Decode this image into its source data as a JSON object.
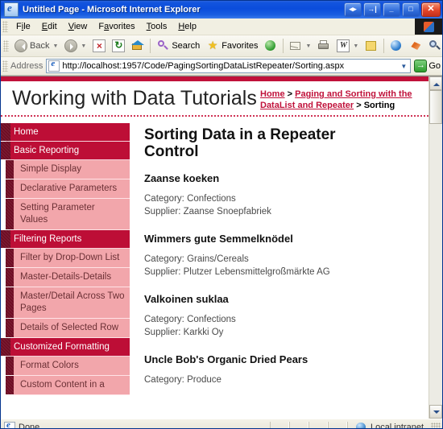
{
  "window": {
    "title": "Untitled Page - Microsoft Internet Explorer",
    "controls": {
      "restore_group_label": "◂▸",
      "split_label": "→|",
      "minimize_label": "_",
      "maximize_label": "□",
      "close_label": "✕"
    }
  },
  "menubar": {
    "items": [
      {
        "pre": "F",
        "accel": "i",
        "post": "le"
      },
      {
        "pre": "",
        "accel": "E",
        "post": "dit"
      },
      {
        "pre": "",
        "accel": "V",
        "post": "iew"
      },
      {
        "pre": "F",
        "accel": "a",
        "post": "vorites"
      },
      {
        "pre": "",
        "accel": "T",
        "post": "ools"
      },
      {
        "pre": "",
        "accel": "H",
        "post": "elp"
      }
    ]
  },
  "toolbar": {
    "back_label": "Back",
    "search_label": "Search",
    "favorites_label": "Favorites"
  },
  "address": {
    "label": "Address",
    "url": "http://localhost:1957/Code/PagingSortingDataListRepeater/Sorting.aspx",
    "go_label": "Go"
  },
  "page": {
    "title": "Working with Data Tutorials",
    "breadcrumb": {
      "home": "Home",
      "sep1": " > ",
      "section": "Paging and Sorting with the DataList and Repeater",
      "sep2": " > ",
      "current": "Sorting"
    },
    "content_heading": "Sorting Data in a Repeater Control",
    "label_category": "Category: ",
    "label_supplier": "Supplier: ",
    "products": [
      {
        "name": "Zaanse koeken",
        "category": "Confections",
        "supplier": "Zaanse Snoepfabriek"
      },
      {
        "name": "Wimmers gute Semmelknödel",
        "category": "Grains/Cereals",
        "supplier": "Plutzer Lebensmittelgroßmärkte AG"
      },
      {
        "name": "Valkoinen suklaa",
        "category": "Confections",
        "supplier": "Karkki Oy"
      },
      {
        "name": "Uncle Bob's Organic Dried Pears",
        "category": "Produce",
        "supplier": ""
      }
    ]
  },
  "sidebar": {
    "items": [
      {
        "label": "Home",
        "type": "section"
      },
      {
        "label": "Basic Reporting",
        "type": "section"
      },
      {
        "label": "Simple Display",
        "type": "item"
      },
      {
        "label": "Declarative Parameters",
        "type": "item"
      },
      {
        "label": "Setting Parameter Values",
        "type": "item"
      },
      {
        "label": "Filtering Reports",
        "type": "section"
      },
      {
        "label": "Filter by Drop-Down List",
        "type": "item"
      },
      {
        "label": "Master-Details-Details",
        "type": "item"
      },
      {
        "label": "Master/Detail Across Two Pages",
        "type": "item"
      },
      {
        "label": "Details of Selected Row",
        "type": "item"
      },
      {
        "label": "Customized Formatting",
        "type": "section"
      },
      {
        "label": "Format Colors",
        "type": "item"
      },
      {
        "label": "Custom Content in a",
        "type": "item"
      }
    ]
  },
  "statusbar": {
    "status": "Done",
    "zone": "Local intranet"
  },
  "colors": {
    "brand_red": "#c0113a",
    "nav_section": "#bd0e36",
    "nav_item": "#f2a6ab",
    "nav_edge": "#6e0b22",
    "titlebar_blue": "#0b4ddb"
  }
}
